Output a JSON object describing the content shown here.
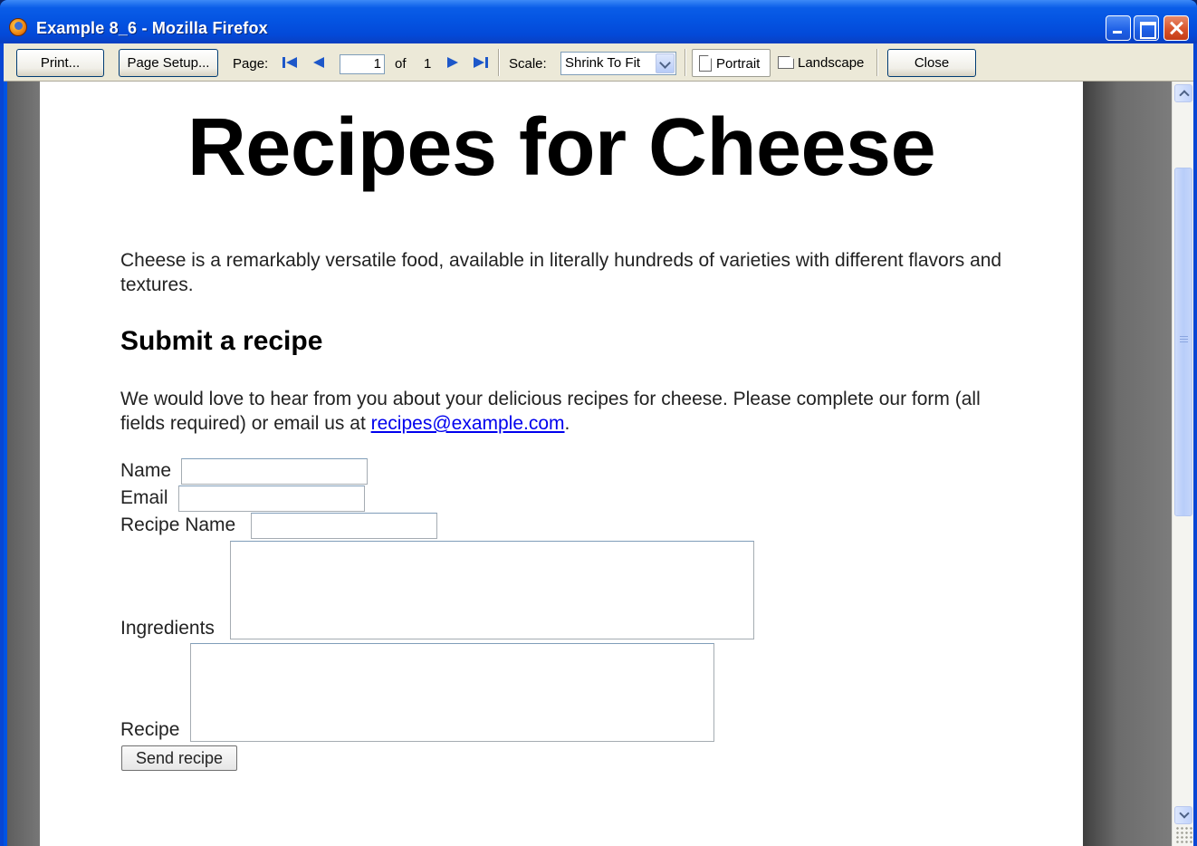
{
  "window": {
    "title": "Example 8_6 - Mozilla Firefox"
  },
  "toolbar": {
    "print_label": "Print...",
    "page_setup_label": "Page Setup...",
    "page_label": "Page:",
    "page_current": "1",
    "page_of_label": "of",
    "page_total": "1",
    "scale_label": "Scale:",
    "scale_value": "Shrink To Fit",
    "portrait_label": "Portrait",
    "landscape_label": "Landscape",
    "close_label": "Close"
  },
  "document": {
    "heading": "Recipes for Cheese",
    "intro": "Cheese is a remarkably versatile food, available in literally hundreds of varieties with different flavors and textures.",
    "subheading": "Submit a recipe",
    "para_text": "We would love to hear from you about your delicious recipes for cheese. Please complete our form (all fields required) or email us at ",
    "email_link": "recipes@example.com",
    "para_end": ".",
    "form": {
      "name_label": "Name",
      "email_label": "Email",
      "recipe_name_label": "Recipe Name",
      "ingredients_label": "Ingredients",
      "recipe_label": "Recipe",
      "submit_label": "Send recipe"
    }
  },
  "colors": {
    "titlebar": "#0453e1",
    "toolbar_bg": "#ece9d8",
    "link": "#0000ee",
    "viewport_bg": "#6a6a6a"
  }
}
